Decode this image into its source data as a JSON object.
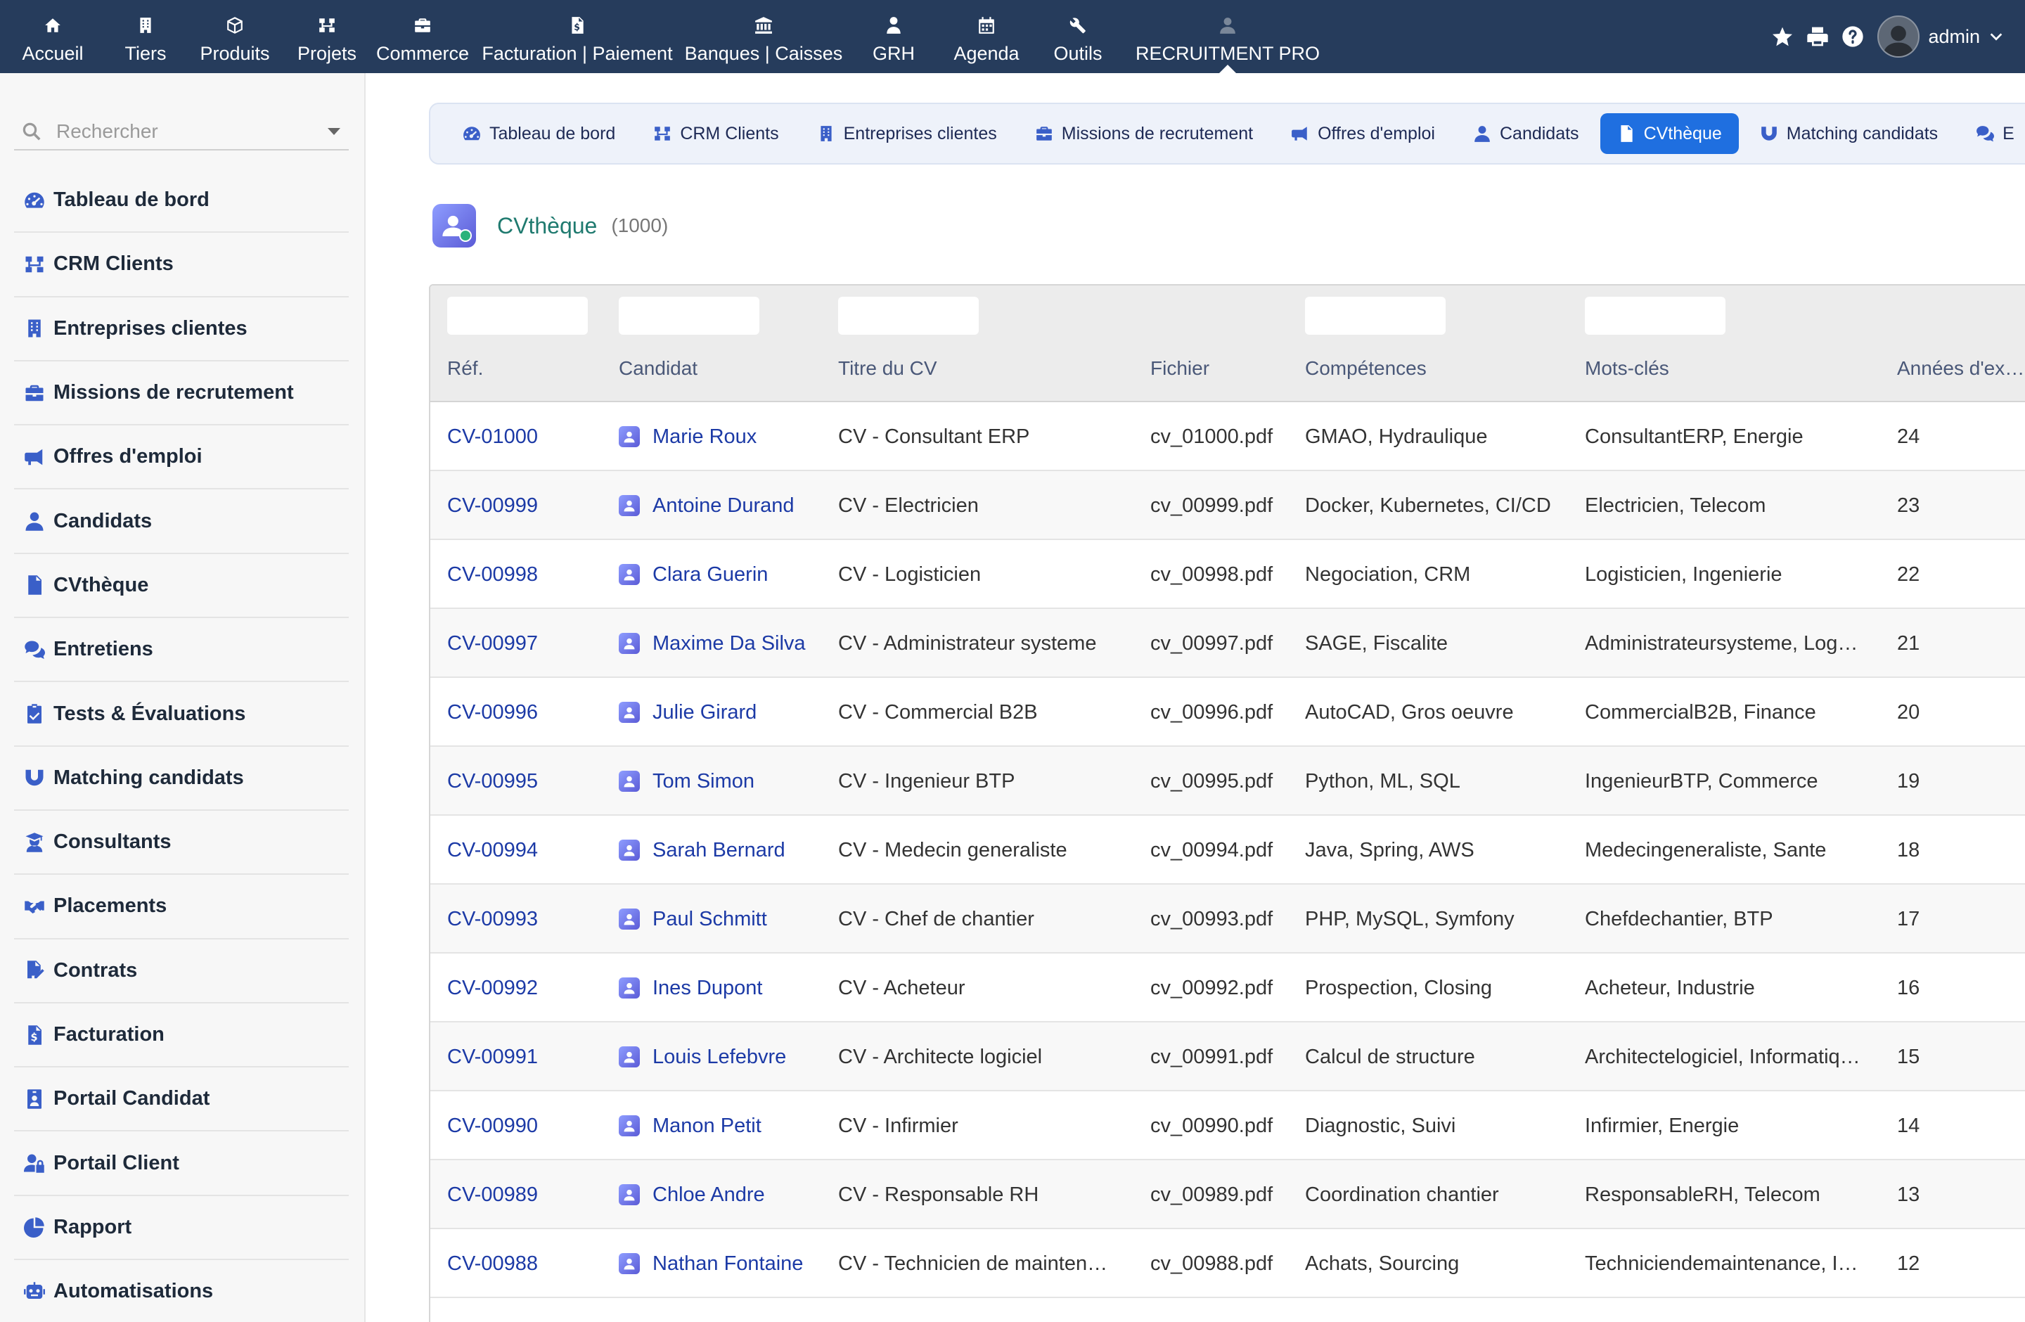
{
  "topnav": [
    {
      "label": "Accueil",
      "icon": "home-icon"
    },
    {
      "label": "Tiers",
      "icon": "building-icon"
    },
    {
      "label": "Produits",
      "icon": "cube-icon"
    },
    {
      "label": "Projets",
      "icon": "sitemap-icon"
    },
    {
      "label": "Commerce",
      "icon": "briefcase-icon"
    },
    {
      "label": "Facturation | Paiement",
      "icon": "invoice-icon"
    },
    {
      "label": "Banques | Caisses",
      "icon": "bank-icon"
    },
    {
      "label": "GRH",
      "icon": "user-tie-icon"
    },
    {
      "label": "Agenda",
      "icon": "calendar-icon"
    },
    {
      "label": "Outils",
      "icon": "tools-icon"
    },
    {
      "label": "RECRUITMENT PRO",
      "icon": "user-icon"
    }
  ],
  "user": {
    "name": "admin"
  },
  "search": {
    "placeholder": "Rechercher"
  },
  "sidebar": {
    "items": [
      {
        "label": "Tableau de bord",
        "icon": "dashboard-icon"
      },
      {
        "label": "CRM Clients",
        "icon": "sitemap-icon"
      },
      {
        "label": "Entreprises clientes",
        "icon": "building-icon"
      },
      {
        "label": "Missions de recrutement",
        "icon": "briefcase-icon"
      },
      {
        "label": "Offres d'emploi",
        "icon": "megaphone-icon"
      },
      {
        "label": "Candidats",
        "icon": "user-icon"
      },
      {
        "label": "CVthèque",
        "icon": "file-icon"
      },
      {
        "label": "Entretiens",
        "icon": "comments-icon"
      },
      {
        "label": "Tests & Évaluations",
        "icon": "clipboard-check-icon"
      },
      {
        "label": "Matching candidats",
        "icon": "magnet-icon"
      },
      {
        "label": "Consultants",
        "icon": "user-graduate-icon"
      },
      {
        "label": "Placements",
        "icon": "handshake-icon"
      },
      {
        "label": "Contrats",
        "icon": "file-signature-icon"
      },
      {
        "label": "Facturation",
        "icon": "invoice-icon"
      },
      {
        "label": "Portail Candidat",
        "icon": "id-badge-icon"
      },
      {
        "label": "Portail Client",
        "icon": "user-lock-icon"
      },
      {
        "label": "Rapport",
        "icon": "chart-pie-icon"
      },
      {
        "label": "Automatisations",
        "icon": "robot-icon"
      }
    ]
  },
  "subnav": [
    {
      "label": "Tableau de bord",
      "icon": "dashboard-icon"
    },
    {
      "label": "CRM Clients",
      "icon": "sitemap-icon"
    },
    {
      "label": "Entreprises clientes",
      "icon": "building-icon"
    },
    {
      "label": "Missions de recrutement",
      "icon": "briefcase-icon"
    },
    {
      "label": "Offres d'emploi",
      "icon": "megaphone-icon"
    },
    {
      "label": "Candidats",
      "icon": "user-icon"
    },
    {
      "label": "CVthèque",
      "icon": "file-icon"
    },
    {
      "label": "Matching candidats",
      "icon": "magnet-icon"
    },
    {
      "label": "E",
      "icon": "comments-icon"
    }
  ],
  "page": {
    "title": "CVthèque",
    "count": "(1000)"
  },
  "table": {
    "columns": [
      "Réf.",
      "Candidat",
      "Titre du CV",
      "Fichier",
      "Compétences",
      "Mots-clés",
      "Années d'ex…"
    ],
    "rows": [
      [
        "CV-01000",
        "Marie Roux",
        "CV - Consultant ERP",
        "cv_01000.pdf",
        "GMAO, Hydraulique",
        "ConsultantERP, Energie",
        "24"
      ],
      [
        "CV-00999",
        "Antoine Durand",
        "CV - Electricien",
        "cv_00999.pdf",
        "Docker, Kubernetes, CI/CD",
        "Electricien, Telecom",
        "23"
      ],
      [
        "CV-00998",
        "Clara Guerin",
        "CV - Logisticien",
        "cv_00998.pdf",
        "Negociation, CRM",
        "Logisticien, Ingenierie",
        "22"
      ],
      [
        "CV-00997",
        "Maxime Da Silva",
        "CV - Administrateur systeme",
        "cv_00997.pdf",
        "SAGE, Fiscalite",
        "Administrateursysteme, Log…",
        "21"
      ],
      [
        "CV-00996",
        "Julie Girard",
        "CV - Commercial B2B",
        "cv_00996.pdf",
        "AutoCAD, Gros oeuvre",
        "CommercialB2B, Finance",
        "20"
      ],
      [
        "CV-00995",
        "Tom Simon",
        "CV - Ingenieur BTP",
        "cv_00995.pdf",
        "Python, ML, SQL",
        "IngenieurBTP, Commerce",
        "19"
      ],
      [
        "CV-00994",
        "Sarah Bernard",
        "CV - Medecin generaliste",
        "cv_00994.pdf",
        "Java, Spring, AWS",
        "Medecingeneraliste, Sante",
        "18"
      ],
      [
        "CV-00993",
        "Paul Schmitt",
        "CV - Chef de chantier",
        "cv_00993.pdf",
        "PHP, MySQL, Symfony",
        "Chefdechantier, BTP",
        "17"
      ],
      [
        "CV-00992",
        "Ines Dupont",
        "CV - Acheteur",
        "cv_00992.pdf",
        "Prospection, Closing",
        "Acheteur, Industrie",
        "16"
      ],
      [
        "CV-00991",
        "Louis Lefebvre",
        "CV - Architecte logiciel",
        "cv_00991.pdf",
        "Calcul de structure",
        "Architectelogiciel, Informatiq…",
        "15"
      ],
      [
        "CV-00990",
        "Manon Petit",
        "CV - Infirmier",
        "cv_00990.pdf",
        "Diagnostic, Suivi",
        "Infirmier, Energie",
        "14"
      ],
      [
        "CV-00989",
        "Chloe Andre",
        "CV - Responsable RH",
        "cv_00989.pdf",
        "Coordination chantier",
        "ResponsableRH, Telecom",
        "13"
      ],
      [
        "CV-00988",
        "Nathan Fontaine",
        "CV - Technicien de mainten…",
        "cv_00988.pdf",
        "Achats, Sourcing",
        "Techniciendemaintenance, I…",
        "12"
      ]
    ]
  },
  "colors": {
    "topbar": "#263c5c",
    "accent": "#1f6fe0",
    "title": "#1f7a6f",
    "link": "#1c3aa6"
  }
}
